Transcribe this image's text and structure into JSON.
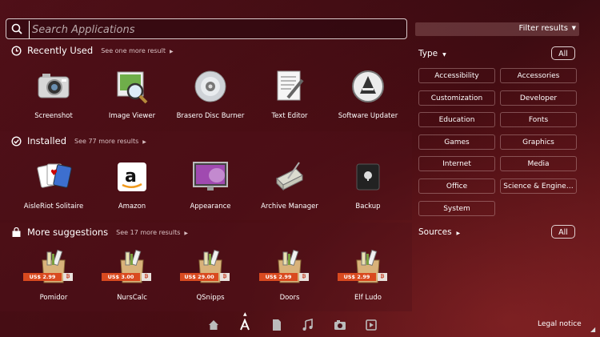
{
  "search": {
    "placeholder": "Search Applications"
  },
  "categories": [
    {
      "title": "Recently Used",
      "more": "See one more result",
      "apps": [
        {
          "name": "Screenshot",
          "icon": "camera-icon"
        },
        {
          "name": "Image Viewer",
          "icon": "image-viewer-icon"
        },
        {
          "name": "Brasero Disc Burner",
          "icon": "disc-icon"
        },
        {
          "name": "Text Editor",
          "icon": "text-editor-icon"
        },
        {
          "name": "Software Updater",
          "icon": "updater-icon"
        }
      ]
    },
    {
      "title": "Installed",
      "more": "See 77 more results",
      "apps": [
        {
          "name": "AisleRiot Solitaire",
          "icon": "cards-icon"
        },
        {
          "name": "Amazon",
          "icon": "amazon-icon"
        },
        {
          "name": "Appearance",
          "icon": "monitor-icon"
        },
        {
          "name": "Archive Manager",
          "icon": "archive-icon"
        },
        {
          "name": "Backup",
          "icon": "safe-icon"
        }
      ]
    },
    {
      "title": "More suggestions",
      "more": "See 17 more results",
      "apps": [
        {
          "name": "Pomidor",
          "price": "US$ 2.99",
          "icon": "package-icon"
        },
        {
          "name": "NursCalc",
          "price": "US$ 3.00",
          "icon": "package-icon"
        },
        {
          "name": "QSnipps",
          "price": "US$ 29.00",
          "icon": "package-icon"
        },
        {
          "name": "Doors",
          "price": "US$ 2.99",
          "icon": "package-icon"
        },
        {
          "name": "Elf Ludo",
          "price": "US$ 2.99",
          "icon": "package-icon"
        }
      ]
    }
  ],
  "filter": {
    "label": "Filter results",
    "type_label": "Type",
    "all_label": "All",
    "types": [
      "Accessibility",
      "Accessories",
      "Customization",
      "Developer",
      "Education",
      "Fonts",
      "Games",
      "Graphics",
      "Internet",
      "Media",
      "Office",
      "Science & Engine…",
      "System"
    ],
    "sources_label": "Sources",
    "sources_all": "All"
  },
  "bottom": {
    "lenses": [
      "home-icon",
      "applications-icon",
      "files-icon",
      "music-icon",
      "photos-icon",
      "video-icon"
    ],
    "legal": "Legal notice"
  },
  "colors": {
    "accent": "#d94a1f",
    "background": "#4e0e14"
  }
}
